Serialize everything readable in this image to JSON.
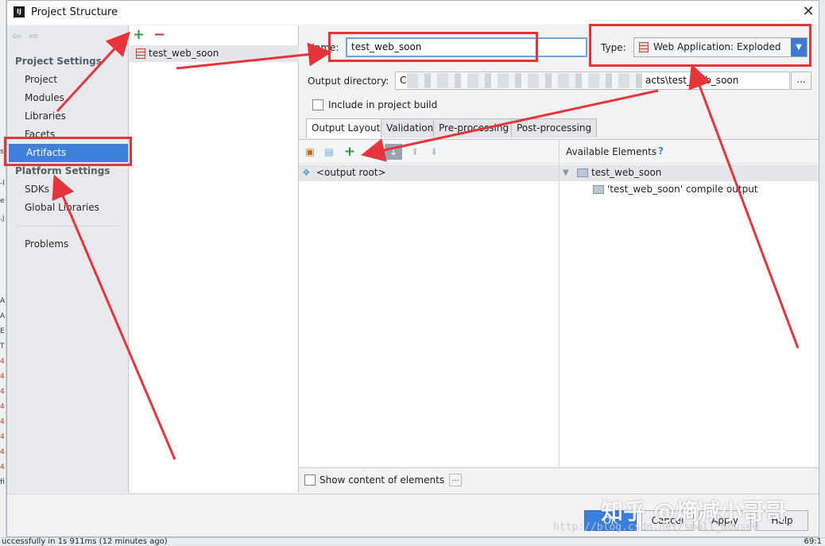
{
  "window": {
    "title": "Project Structure",
    "app_icon": "IJ",
    "close_glyph": "✕"
  },
  "nav": {
    "back": "⇦",
    "forward": "⇨",
    "project_settings_heading": "Project Settings",
    "platform_settings_heading": "Platform Settings",
    "items": [
      {
        "label": "Project"
      },
      {
        "label": "Modules"
      },
      {
        "label": "Libraries"
      },
      {
        "label": "Facets"
      },
      {
        "label": "Artifacts"
      },
      {
        "label": "SDKs"
      },
      {
        "label": "Global Libraries"
      },
      {
        "label": "Problems"
      }
    ],
    "selected": "Artifacts"
  },
  "artifacts": {
    "add": "+",
    "remove": "−",
    "items": [
      "test_web_soon"
    ]
  },
  "form": {
    "name_label": "Name:",
    "name_value": "test_web_soon",
    "type_label": "Type:",
    "type_value": "Web Application: Exploded",
    "output_dir_label": "Output directory:",
    "output_dir_prefix": "C",
    "output_dir_suffix": "acts\\test_web_soon",
    "browse": "...",
    "include_build_label": "Include in project build"
  },
  "tabs": [
    "Output Layout",
    "Validation",
    "Pre-processing",
    "Post-processing"
  ],
  "layout": {
    "output_root": "<output root>",
    "available_label": "Available Elements",
    "help_glyph": "?",
    "tree": {
      "module": "test_web_soon",
      "compile_output": "'test_web_soon' compile output"
    }
  },
  "show_content_label": "Show content of elements",
  "show_content_button": "...",
  "buttons": {
    "ok": "OK",
    "cancel": "Cancel",
    "apply": "Apply",
    "help": "Help"
  },
  "watermark": {
    "text": "知乎 @熵减小哥哥",
    "url": "http://blog.csdn.net/small_mouse0"
  },
  "status_bar": {
    "message": "uccessfully in 1s 911ms (12 minutes ago)",
    "position": "69:1"
  },
  "ide_edge": [
    "s",
    "-l",
    "e",
    ".j",
    "A",
    "A",
    "E",
    "T",
    "4",
    "4",
    "4",
    "4",
    "4",
    "4",
    "4",
    "4",
    "fi"
  ],
  "colors": {
    "annotation_red": "#e5343a",
    "selection_blue": "#3d7fd9",
    "add_green": "#2a9d3c"
  }
}
